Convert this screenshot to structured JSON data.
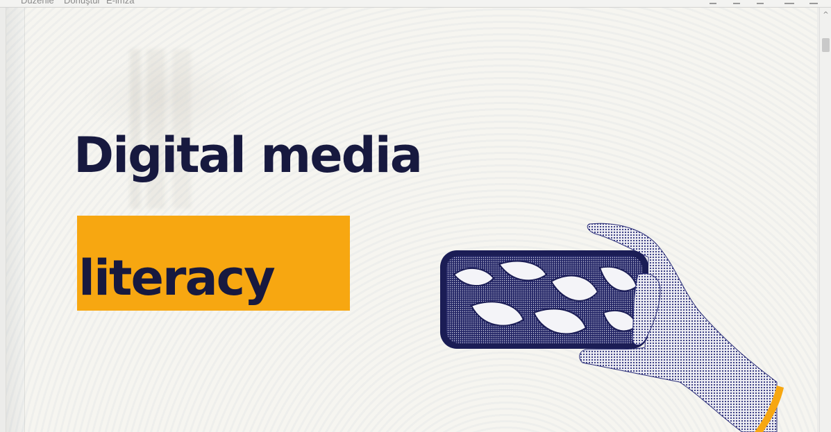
{
  "menu": {
    "items": [
      "Düzenle",
      "Dönüştür",
      "E-imza"
    ]
  },
  "toolbar": {
    "icons": [
      "share-icon",
      "pointer-icon",
      "search-icon",
      "print-icon",
      "user-icon"
    ]
  },
  "slide": {
    "title_line1": "Digital media",
    "title_line2": "literacy",
    "accent_color": "#f7a711",
    "text_color": "#17193f",
    "illustration": "hand-holding-phone-with-mouths"
  },
  "scrollbar": {
    "up_arrow": "^"
  }
}
